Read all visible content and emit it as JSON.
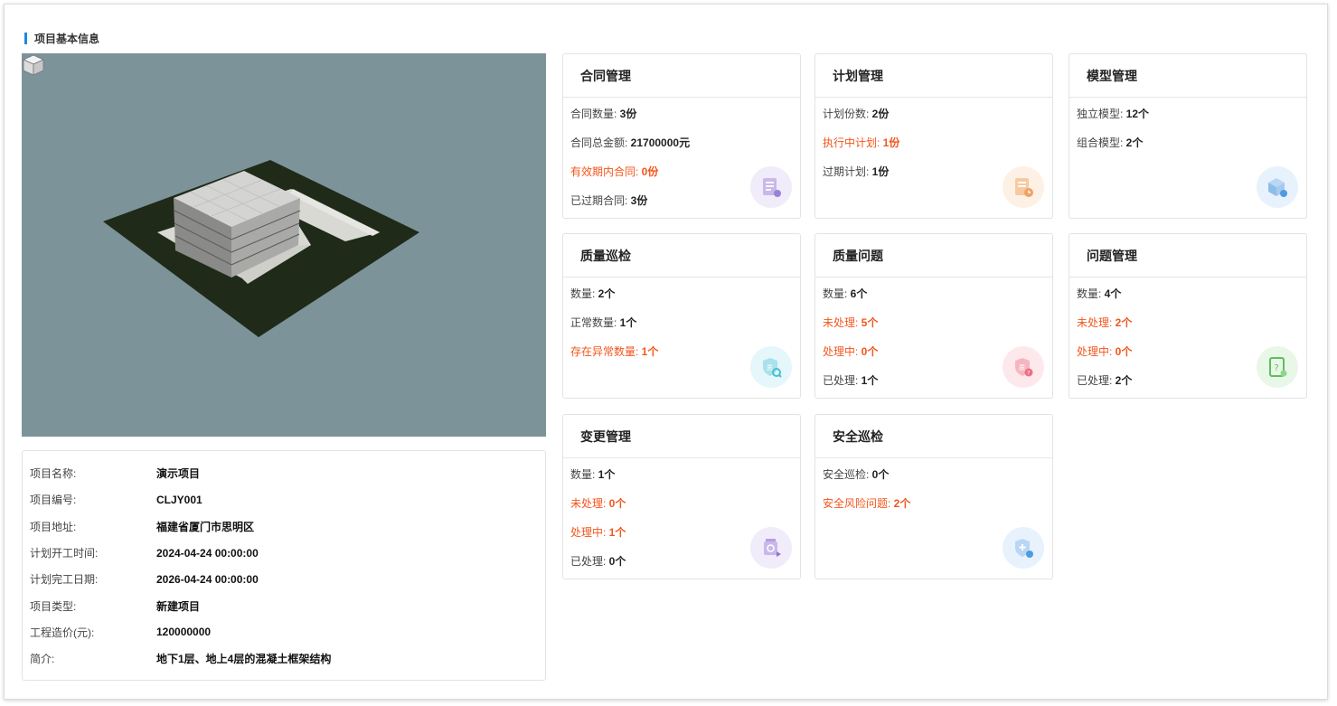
{
  "section_title": "项目基本信息",
  "project_info": [
    {
      "label": "项目名称:",
      "value": "演示项目"
    },
    {
      "label": "项目编号:",
      "value": "CLJY001"
    },
    {
      "label": "项目地址:",
      "value": "福建省厦门市思明区"
    },
    {
      "label": "计划开工时间:",
      "value": "2024-04-24 00:00:00"
    },
    {
      "label": "计划完工日期:",
      "value": "2026-04-24 00:00:00"
    },
    {
      "label": "项目类型:",
      "value": "新建项目"
    },
    {
      "label": "工程造价(元):",
      "value": "120000000"
    },
    {
      "label": "简介:",
      "value": "地下1层、地上4层的混凝土框架结构"
    }
  ],
  "cards": [
    {
      "title": "合同管理",
      "icon": "contract-icon",
      "stats": [
        {
          "label": "合同数量: ",
          "value": "3份",
          "warn": false
        },
        {
          "label": "合同总金额: ",
          "value": "21700000元",
          "warn": false
        },
        {
          "label": "有效期内合同: ",
          "value": "0份",
          "warn": true
        },
        {
          "label": "已过期合同: ",
          "value": "3份",
          "warn": false
        }
      ]
    },
    {
      "title": "计划管理",
      "icon": "plan-clock-icon",
      "stats": [
        {
          "label": "计划份数: ",
          "value": "2份",
          "warn": false
        },
        {
          "label": "执行中计划: ",
          "value": "1份",
          "warn": true
        },
        {
          "label": "过期计划: ",
          "value": "1份",
          "warn": false
        }
      ]
    },
    {
      "title": "模型管理",
      "icon": "model-cube-icon",
      "stats": [
        {
          "label": "独立模型: ",
          "value": "12个",
          "warn": false
        },
        {
          "label": "组合模型: ",
          "value": "2个",
          "warn": false
        }
      ]
    },
    {
      "title": "质量巡检",
      "icon": "quality-inspect-icon",
      "stats": [
        {
          "label": "数量: ",
          "value": "2个",
          "warn": false
        },
        {
          "label": "正常数量: ",
          "value": "1个",
          "warn": false
        },
        {
          "label": "存在异常数量: ",
          "value": "1个",
          "warn": true
        }
      ]
    },
    {
      "title": "质量问题",
      "icon": "quality-problem-icon",
      "stats": [
        {
          "label": "数量: ",
          "value": "6个",
          "warn": false
        },
        {
          "label": "未处理: ",
          "value": "5个",
          "warn": true
        },
        {
          "label": "处理中: ",
          "value": "0个",
          "warn": true
        },
        {
          "label": "已处理: ",
          "value": "1个",
          "warn": false
        }
      ]
    },
    {
      "title": "问题管理",
      "icon": "issue-icon",
      "stats": [
        {
          "label": "数量: ",
          "value": "4个",
          "warn": false
        },
        {
          "label": "未处理: ",
          "value": "2个",
          "warn": true
        },
        {
          "label": "处理中: ",
          "value": "0个",
          "warn": true
        },
        {
          "label": "已处理: ",
          "value": "2个",
          "warn": false
        }
      ]
    },
    {
      "title": "变更管理",
      "icon": "change-icon",
      "stats": [
        {
          "label": "数量: ",
          "value": "1个",
          "warn": false
        },
        {
          "label": "未处理: ",
          "value": "0个",
          "warn": true
        },
        {
          "label": "处理中: ",
          "value": "1个",
          "warn": true
        },
        {
          "label": "已处理: ",
          "value": "0个",
          "warn": false
        }
      ]
    },
    {
      "title": "安全巡检",
      "icon": "safety-shield-icon",
      "stats": [
        {
          "label": "安全巡检: ",
          "value": "0个",
          "warn": false
        },
        {
          "label": "安全风险问题: ",
          "value": "2个",
          "warn": true
        }
      ]
    }
  ],
  "colors": {
    "accent": "#1e88e5",
    "warning": "#f2561d",
    "viewer_bg": "#7d939a"
  }
}
